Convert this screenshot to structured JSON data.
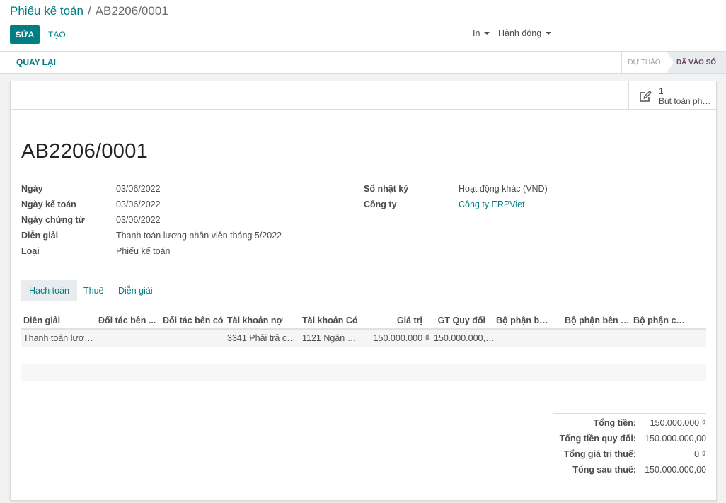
{
  "breadcrumb": {
    "parent": "Phiếu kế toán",
    "separator": "/",
    "current": "AB2206/0001"
  },
  "toolbar": {
    "edit_label": "SỬA",
    "create_label": "TẠO",
    "print_label": "In",
    "action_label": "Hành động"
  },
  "statusbar": {
    "back_label": "QUAY LẠI",
    "stages": [
      "DỰ THẢO",
      "ĐÃ VÀO SỔ"
    ],
    "active_stage": "ĐÃ VÀO SỔ"
  },
  "smart_button": {
    "icon": "edit-icon",
    "count": "1",
    "label": "Bút toán phá..."
  },
  "record": {
    "title": "AB2206/0001",
    "left_fields": [
      {
        "label": "Ngày",
        "value": "03/06/2022"
      },
      {
        "label": "Ngày kế toán",
        "value": "03/06/2022"
      },
      {
        "label": "Ngày chứng từ",
        "value": "03/06/2022"
      },
      {
        "label": "Diễn giải",
        "value": "Thanh toán lương nhân viên tháng 5/2022"
      },
      {
        "label": "Loại",
        "value": "Phiếu kế toán"
      }
    ],
    "right_fields": [
      {
        "label": "Sổ nhật ký",
        "value": "Hoạt động khác (VND)"
      },
      {
        "label": "Công ty",
        "value": "Công ty ERPViet"
      }
    ]
  },
  "tabs": [
    "Hạch toán",
    "Thuế",
    "Diễn giải"
  ],
  "active_tab": "Hạch toán",
  "lines_table": {
    "headers": [
      "Diễn giải",
      "Đối tác bên ...",
      "Đối tác bên có",
      "Tài khoản nợ",
      "Tài khoản Có",
      "Giá trị",
      "GT Quy đổi",
      "Bộ phận bên ...",
      "Bộ phận bên có",
      "Bộ phận chị..."
    ],
    "rows": [
      [
        "Thanh toán lương...",
        "",
        "",
        "3341 Phải trả côn...",
        "1121 Ngân hà...",
        "150.000.000 ₫",
        "150.000.000,00",
        "",
        "",
        ""
      ]
    ]
  },
  "totals": [
    {
      "label": "Tổng tiền:",
      "value": "150.000.000 ₫"
    },
    {
      "label": "Tổng tiền quy đổi:",
      "value": "150.000.000,00"
    },
    {
      "label": "Tổng giá trị thuế:",
      "value": "0 ₫"
    },
    {
      "label": "Tổng sau thuế:",
      "value": "150.000.000,00"
    }
  ],
  "colors": {
    "primary": "#017e84",
    "status_active": "#6e4b63"
  }
}
